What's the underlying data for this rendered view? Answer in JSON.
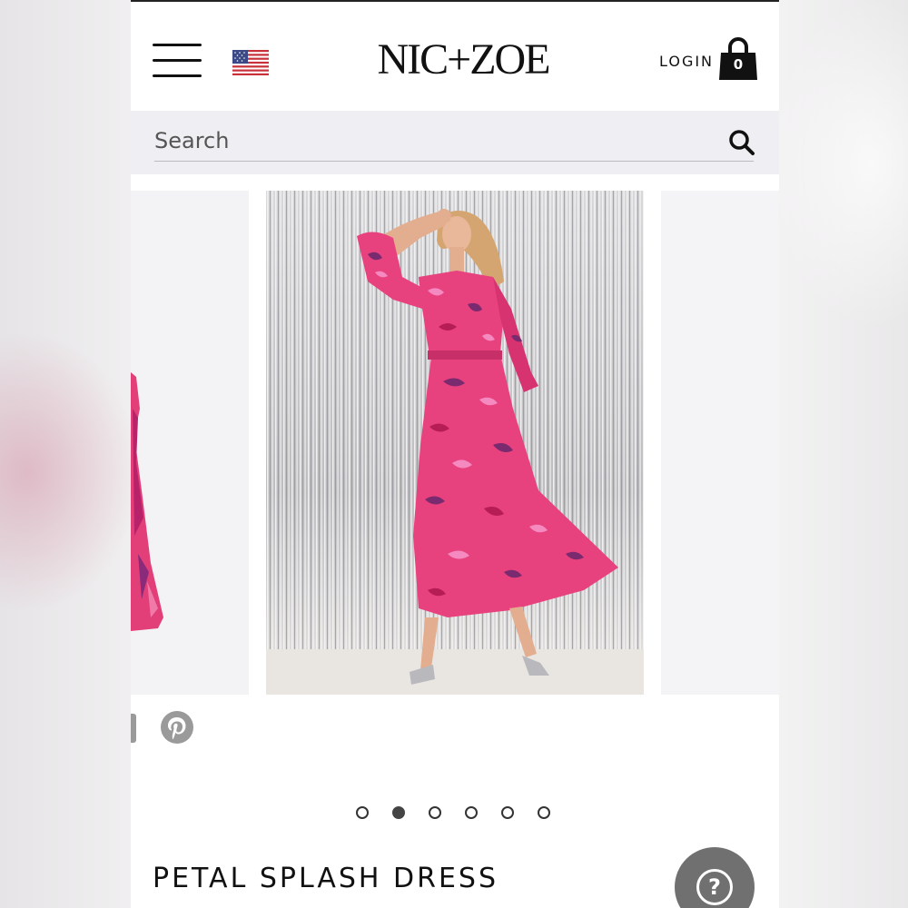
{
  "header": {
    "brand": "NIC+ZOE",
    "login_label": "LOGIN",
    "cart_count": "0",
    "menu_icon": "hamburger-menu-icon",
    "region_flag": "us-flag-icon"
  },
  "search": {
    "placeholder": "Search",
    "icon": "search-icon"
  },
  "carousel": {
    "slide_count": 6,
    "active_index": 1,
    "main_image": "woman in pink patterned maxi dress in front of silver tinsel curtain"
  },
  "social": {
    "icons": [
      "share-icon",
      "pinterest-icon"
    ]
  },
  "product": {
    "title": "PETAL SPLASH DRESS"
  },
  "help": {
    "glyph": "?"
  },
  "colors": {
    "accent": "#111111",
    "dress_pink": "#e8427e",
    "help_bg": "#707070"
  }
}
